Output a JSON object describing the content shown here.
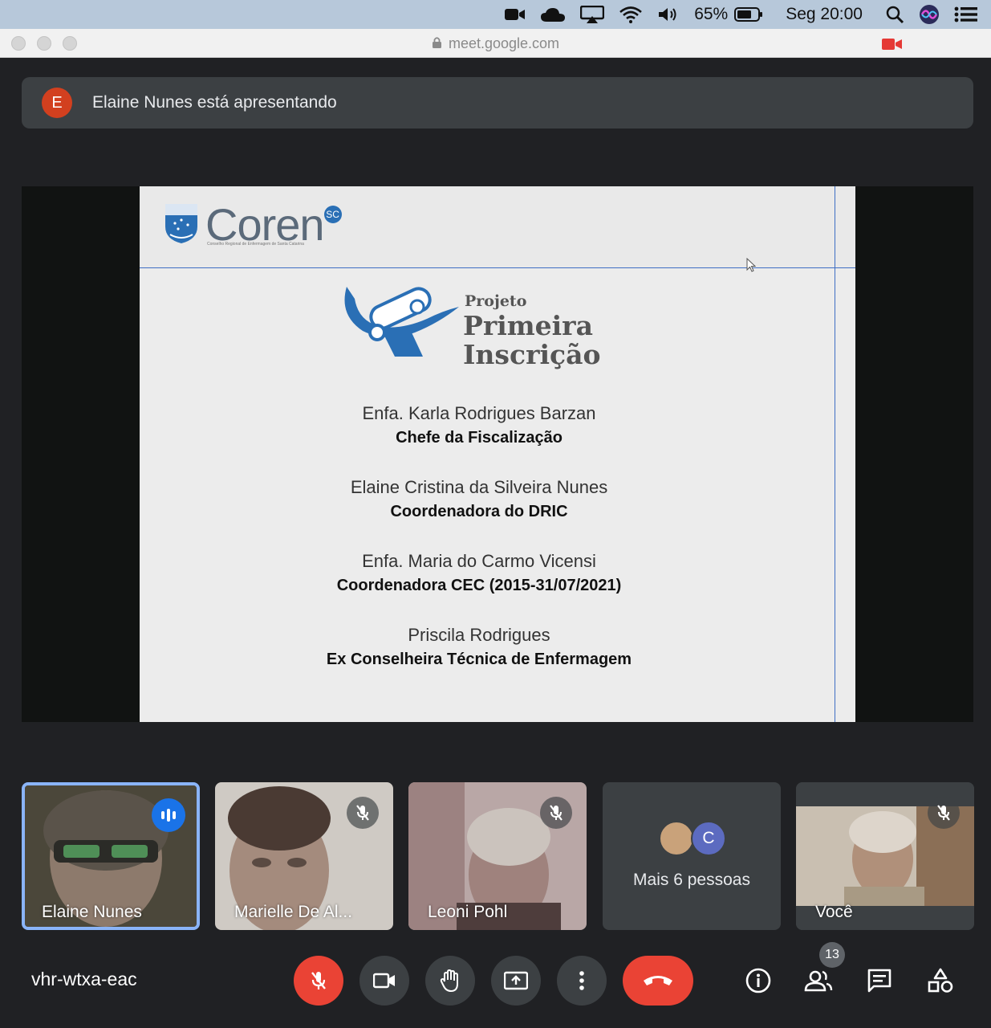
{
  "menubar": {
    "battery": "65%",
    "clock": "Seg 20:00",
    "icons": [
      "facetime-icon",
      "cloud-icon",
      "airplay-icon",
      "wifi-icon",
      "volume-icon",
      "battery-icon",
      "spotlight-icon",
      "siri-icon",
      "control-center-icon"
    ]
  },
  "browser": {
    "url": "meet.google.com"
  },
  "banner": {
    "avatar_letter": "E",
    "text": "Elaine Nunes está apresentando"
  },
  "slide": {
    "logo_text": "Coren",
    "logo_badge": "SC",
    "logo_subtitle": "Conselho Regional de Enfermagem de Santa Catarina",
    "project_small": "Projeto",
    "project_line1": "Primeira",
    "project_line2": "Inscrição",
    "people": [
      {
        "name": "Enfa. Karla Rodrigues Barzan",
        "role": "Chefe da Fiscalização"
      },
      {
        "name": "Elaine Cristina da Silveira Nunes",
        "role": "Coordenadora do DRIC"
      },
      {
        "name": "Enfa. Maria do Carmo Vicensi",
        "role": "Coordenadora CEC (2015-31/07/2021)"
      },
      {
        "name": "Priscila Rodrigues",
        "role": "Ex Conselheira Técnica de Enfermagem"
      }
    ]
  },
  "tiles": [
    {
      "name": "Elaine Nunes",
      "speaking": true,
      "bg": "#4d4a3c"
    },
    {
      "name": "Marielle De Al...",
      "muted": true,
      "bg": "#7c716a"
    },
    {
      "name": "Leoni Pohl",
      "muted": true,
      "bg": "#857371"
    },
    {
      "more_label": "Mais 6 pessoas",
      "avatar_letter": "C"
    },
    {
      "name": "Você",
      "muted": true,
      "bg": "#9a8b76"
    }
  ],
  "bottom": {
    "meeting_code": "vhr-wtxa-eac",
    "participants_count": "13"
  },
  "colors": {
    "meet_bg": "#202124",
    "red": "#ea4335",
    "active_border": "#8ab4f8",
    "speaking_blue": "#1a73e8"
  }
}
